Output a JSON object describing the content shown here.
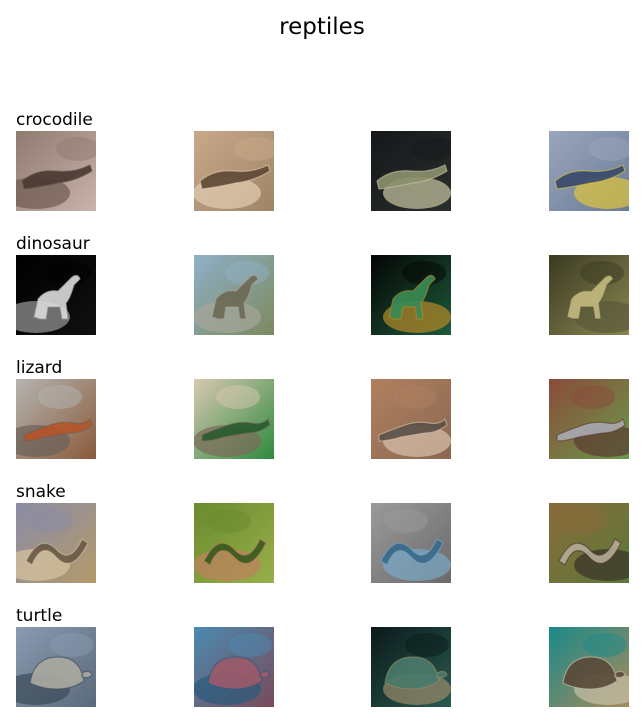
{
  "title": "reptiles",
  "rows": [
    {
      "label": "crocodile",
      "images": [
        {
          "alt": "crocodile-photo-1",
          "palette": [
            "#8f7a70",
            "#c9b3ad",
            "#4a3a32",
            "#6d5a4e"
          ],
          "subject": "crocodile"
        },
        {
          "alt": "crocodile-photo-2",
          "palette": [
            "#c8a98a",
            "#a08466",
            "#5e4a35",
            "#e2cdb4"
          ],
          "subject": "crocodile"
        },
        {
          "alt": "crocodile-photo-3",
          "palette": [
            "#15181a",
            "#2a2e2c",
            "#8a8f6a",
            "#c9c7a4"
          ],
          "subject": "crocodile"
        },
        {
          "alt": "crocodile-photo-4",
          "palette": [
            "#9aa6bd",
            "#6b7a96",
            "#3a4a6e",
            "#e0c63a"
          ],
          "subject": "crocodile"
        }
      ]
    },
    {
      "label": "dinosaur",
      "images": [
        {
          "alt": "dinosaur-photo-1",
          "palette": [
            "#000000",
            "#101010",
            "#d8d8d8",
            "#9a9a9a"
          ],
          "subject": "dinosaur"
        },
        {
          "alt": "dinosaur-photo-2",
          "palette": [
            "#8fb0c8",
            "#7b8a5c",
            "#6c6a55",
            "#a7a59a"
          ],
          "subject": "dinosaur"
        },
        {
          "alt": "dinosaur-photo-3",
          "palette": [
            "#040404",
            "#1d5a3a",
            "#3a8a55",
            "#b88a2a"
          ],
          "subject": "dinosaur"
        },
        {
          "alt": "dinosaur-photo-4",
          "palette": [
            "#3a3a22",
            "#8a8650",
            "#c2b880",
            "#5a5a3a"
          ],
          "subject": "dinosaur"
        }
      ]
    },
    {
      "label": "lizard",
      "images": [
        {
          "alt": "lizard-photo-1",
          "palette": [
            "#b4b4b0",
            "#8a5a3a",
            "#b5552a",
            "#6a6058"
          ],
          "subject": "lizard"
        },
        {
          "alt": "lizard-photo-2",
          "palette": [
            "#d8c8b0",
            "#2e8a3e",
            "#2a5a30",
            "#7a6a58"
          ],
          "subject": "lizard"
        },
        {
          "alt": "lizard-photo-3",
          "palette": [
            "#b08060",
            "#8a6850",
            "#5a5048",
            "#d8c2ac"
          ],
          "subject": "lizard"
        },
        {
          "alt": "lizard-photo-4",
          "palette": [
            "#8a4a3a",
            "#6a9a4a",
            "#a8a8b0",
            "#5a3a30"
          ],
          "subject": "lizard"
        }
      ]
    },
    {
      "label": "snake",
      "images": [
        {
          "alt": "snake-photo-1",
          "palette": [
            "#8a8ca6",
            "#b49a6a",
            "#6a5a48",
            "#d8c4a0"
          ],
          "subject": "snake"
        },
        {
          "alt": "snake-photo-2",
          "palette": [
            "#6a8a2e",
            "#98b04a",
            "#3a5a1e",
            "#c08060"
          ],
          "subject": "snake"
        },
        {
          "alt": "snake-photo-3",
          "palette": [
            "#9a9a9a",
            "#6a6a6a",
            "#3a6a8a",
            "#7aa8c8"
          ],
          "subject": "snake"
        },
        {
          "alt": "snake-photo-4",
          "palette": [
            "#8a6a3a",
            "#5a7a3a",
            "#b4a894",
            "#3a3028"
          ],
          "subject": "snake"
        }
      ]
    },
    {
      "label": "turtle",
      "images": [
        {
          "alt": "turtle-photo-1",
          "palette": [
            "#8a9ab0",
            "#5a6a7a",
            "#a8a8a0",
            "#3a4a58"
          ],
          "subject": "turtle"
        },
        {
          "alt": "turtle-photo-2",
          "palette": [
            "#4a8ab0",
            "#7a4a5a",
            "#9a5a6a",
            "#2a5a7a"
          ],
          "subject": "turtle"
        },
        {
          "alt": "turtle-photo-3",
          "palette": [
            "#0a1a1a",
            "#2a5a50",
            "#4a7a6a",
            "#9a8a6a"
          ],
          "subject": "turtle"
        },
        {
          "alt": "turtle-photo-4",
          "palette": [
            "#1a8a8a",
            "#a88a5a",
            "#5a4a3a",
            "#c8c0a8"
          ],
          "subject": "turtle"
        }
      ]
    }
  ]
}
